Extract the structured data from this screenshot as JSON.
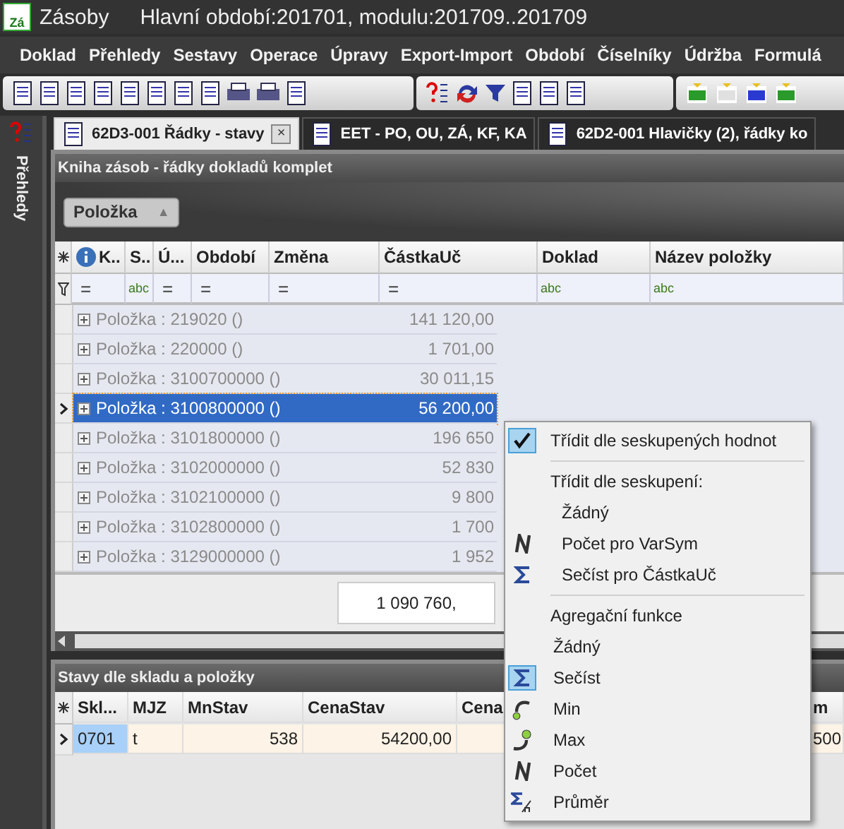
{
  "window": {
    "logo": "Zá",
    "app": "Zásoby",
    "title": "Hlavní období:201701, modulu:201709..201709"
  },
  "menu": [
    "Doklad",
    "Přehledy",
    "Sestavy",
    "Operace",
    "Úpravy",
    "Export-Import",
    "Období",
    "Číselníky",
    "Údržba",
    "Formulá"
  ],
  "side_panel": {
    "label": "Přehledy"
  },
  "tabs": [
    {
      "label": "62D3-001 Řádky - stavy",
      "selected": true,
      "close": "×"
    },
    {
      "label": "EET - PO, OU, ZÁ, KF, KA",
      "selected": false
    },
    {
      "label": "62D2-001 Hlavičky (2), řádky ko",
      "selected": false
    }
  ],
  "panel": {
    "title": "Kniha zásob - řádky dokladů komplet",
    "group_chip": {
      "label": "Položka",
      "arrow": "▲"
    },
    "columns": [
      {
        "label": "K..",
        "filter": "="
      },
      {
        "label": "S..",
        "filter": "abc"
      },
      {
        "label": "Ú...",
        "filter": "="
      },
      {
        "label": "Období",
        "filter": "="
      },
      {
        "label": "Změna",
        "filter": "="
      },
      {
        "label": "ČástkaUč",
        "filter": "="
      },
      {
        "label": "Doklad",
        "filter": "abc"
      },
      {
        "label": "Název položky",
        "filter": "abc"
      }
    ],
    "rows": [
      {
        "label": "Položka : 219020 ()",
        "amount": "141 120,00",
        "selected": false
      },
      {
        "label": "Položka : 220000 ()",
        "amount": "1 701,00",
        "selected": false
      },
      {
        "label": "Položka : 3100700000 ()",
        "amount": "30 011,15",
        "selected": false
      },
      {
        "label": "Položka : 3100800000 ()",
        "amount": "56 200,00",
        "selected": true
      },
      {
        "label": "Položka : 3101800000 ()",
        "amount": "196 650",
        "selected": false
      },
      {
        "label": "Položka : 3102000000 ()",
        "amount": "52 830",
        "selected": false
      },
      {
        "label": "Položka : 3102100000 ()",
        "amount": "9 800",
        "selected": false
      },
      {
        "label": "Položka : 3102800000 ()",
        "amount": "1 700",
        "selected": false
      },
      {
        "label": "Položka : 3129000000 ()",
        "amount": "1 952",
        "selected": false
      }
    ],
    "total": "1 090 760,"
  },
  "bottom_panel": {
    "title": "Stavy dle skladu a položky",
    "columns": [
      "Skl...",
      "MJZ",
      "MnStav",
      "CenaStav",
      "Cena",
      "m"
    ],
    "rows": [
      {
        "cells": [
          "0701",
          "t",
          "538",
          "54200,00",
          "",
          "500"
        ],
        "selected": true
      }
    ]
  },
  "context_menu": {
    "toggle": {
      "label": "Třídit dle seskupených hodnot",
      "checked": true
    },
    "sort_heading": "Třídit dle seskupení:",
    "sort_options": [
      {
        "label": "Žádný"
      },
      {
        "label": "Počet pro VarSym"
      },
      {
        "label": "Sečíst pro ČástkaUč"
      }
    ],
    "aggregate_heading": "Agregační funkce",
    "aggregate_options": [
      {
        "label": "Žádný",
        "selected": false
      },
      {
        "label": "Sečíst",
        "selected": true
      },
      {
        "label": "Min",
        "selected": false
      },
      {
        "label": "Max",
        "selected": false
      },
      {
        "label": "Počet",
        "selected": false
      },
      {
        "label": "Průměr",
        "selected": false
      }
    ]
  }
}
